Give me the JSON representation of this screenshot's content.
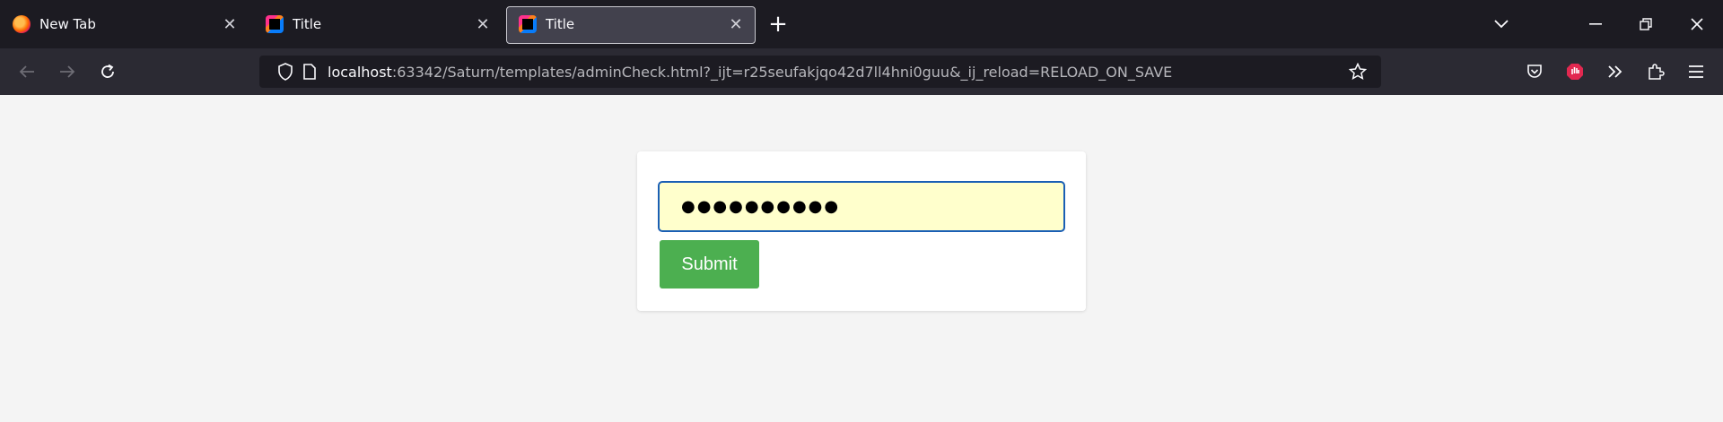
{
  "browser": {
    "tabs": [
      {
        "title": "New Tab",
        "favicon": "firefox-icon",
        "active": false
      },
      {
        "title": "Title",
        "favicon": "intellij-icon",
        "active": false
      },
      {
        "title": "Title",
        "favicon": "intellij-icon",
        "active": true
      }
    ],
    "url": {
      "host": "localhost",
      "rest": ":63342/Saturn/templates/adminCheck.html?_ijt=r25seufakjqo42d7ll4hni0guu&_ij_reload=RELOAD_ON_SAVE"
    }
  },
  "form": {
    "password_value": "●●●●●●●●●●",
    "submit_label": "Submit"
  },
  "colors": {
    "submit_bg": "#4caf50",
    "input_bg": "#ffffcc",
    "input_border": "#1a5fb4"
  }
}
